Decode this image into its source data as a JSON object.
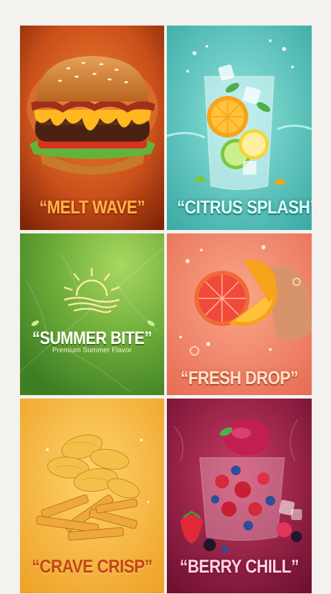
{
  "posters": [
    {
      "title": "“MELT WAVE”",
      "theme": "burger",
      "colors": {
        "bg": "#d65a1e",
        "text": "#ffb347"
      }
    },
    {
      "title": "“CITRUS SPLASH”",
      "theme": "citrus-drink",
      "colors": {
        "bg": "#5ccbc3",
        "text": "#d8fff8"
      }
    },
    {
      "title": "“SUMMER BITE”",
      "subtitle": "Premium Summer Flavor",
      "theme": "sun-logo",
      "colors": {
        "bg": "#6fae3a",
        "text": "#ffffff"
      }
    },
    {
      "title": "“FRESH DROP”",
      "theme": "grapefruit-orange",
      "colors": {
        "bg": "#f28a6a",
        "text": "#ffe0c8"
      }
    },
    {
      "title": "“CRAVE CRISP”",
      "theme": "chips-fries",
      "colors": {
        "bg": "#f2b733",
        "text": "#c4461a"
      }
    },
    {
      "title": "“BERRY CHILL”",
      "theme": "berry-sorbet",
      "colors": {
        "bg": "#9b1f45",
        "text": "#ffd2e0"
      }
    }
  ]
}
